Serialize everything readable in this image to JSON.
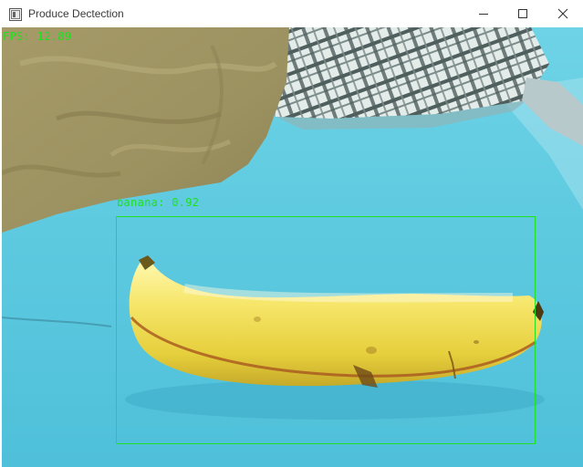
{
  "window": {
    "title": "Produce Dectection",
    "controls": {
      "minimize_icon": "minimize-icon",
      "maximize_icon": "maximize-icon",
      "close_icon": "close-icon"
    }
  },
  "overlay": {
    "fps_text": "FPS: 12.89",
    "text_color": "#1fe01f"
  },
  "detections": [
    {
      "label_text": "banana: 0.92",
      "class": "banana",
      "confidence": 0.92,
      "box_color": "#22e022"
    }
  ]
}
